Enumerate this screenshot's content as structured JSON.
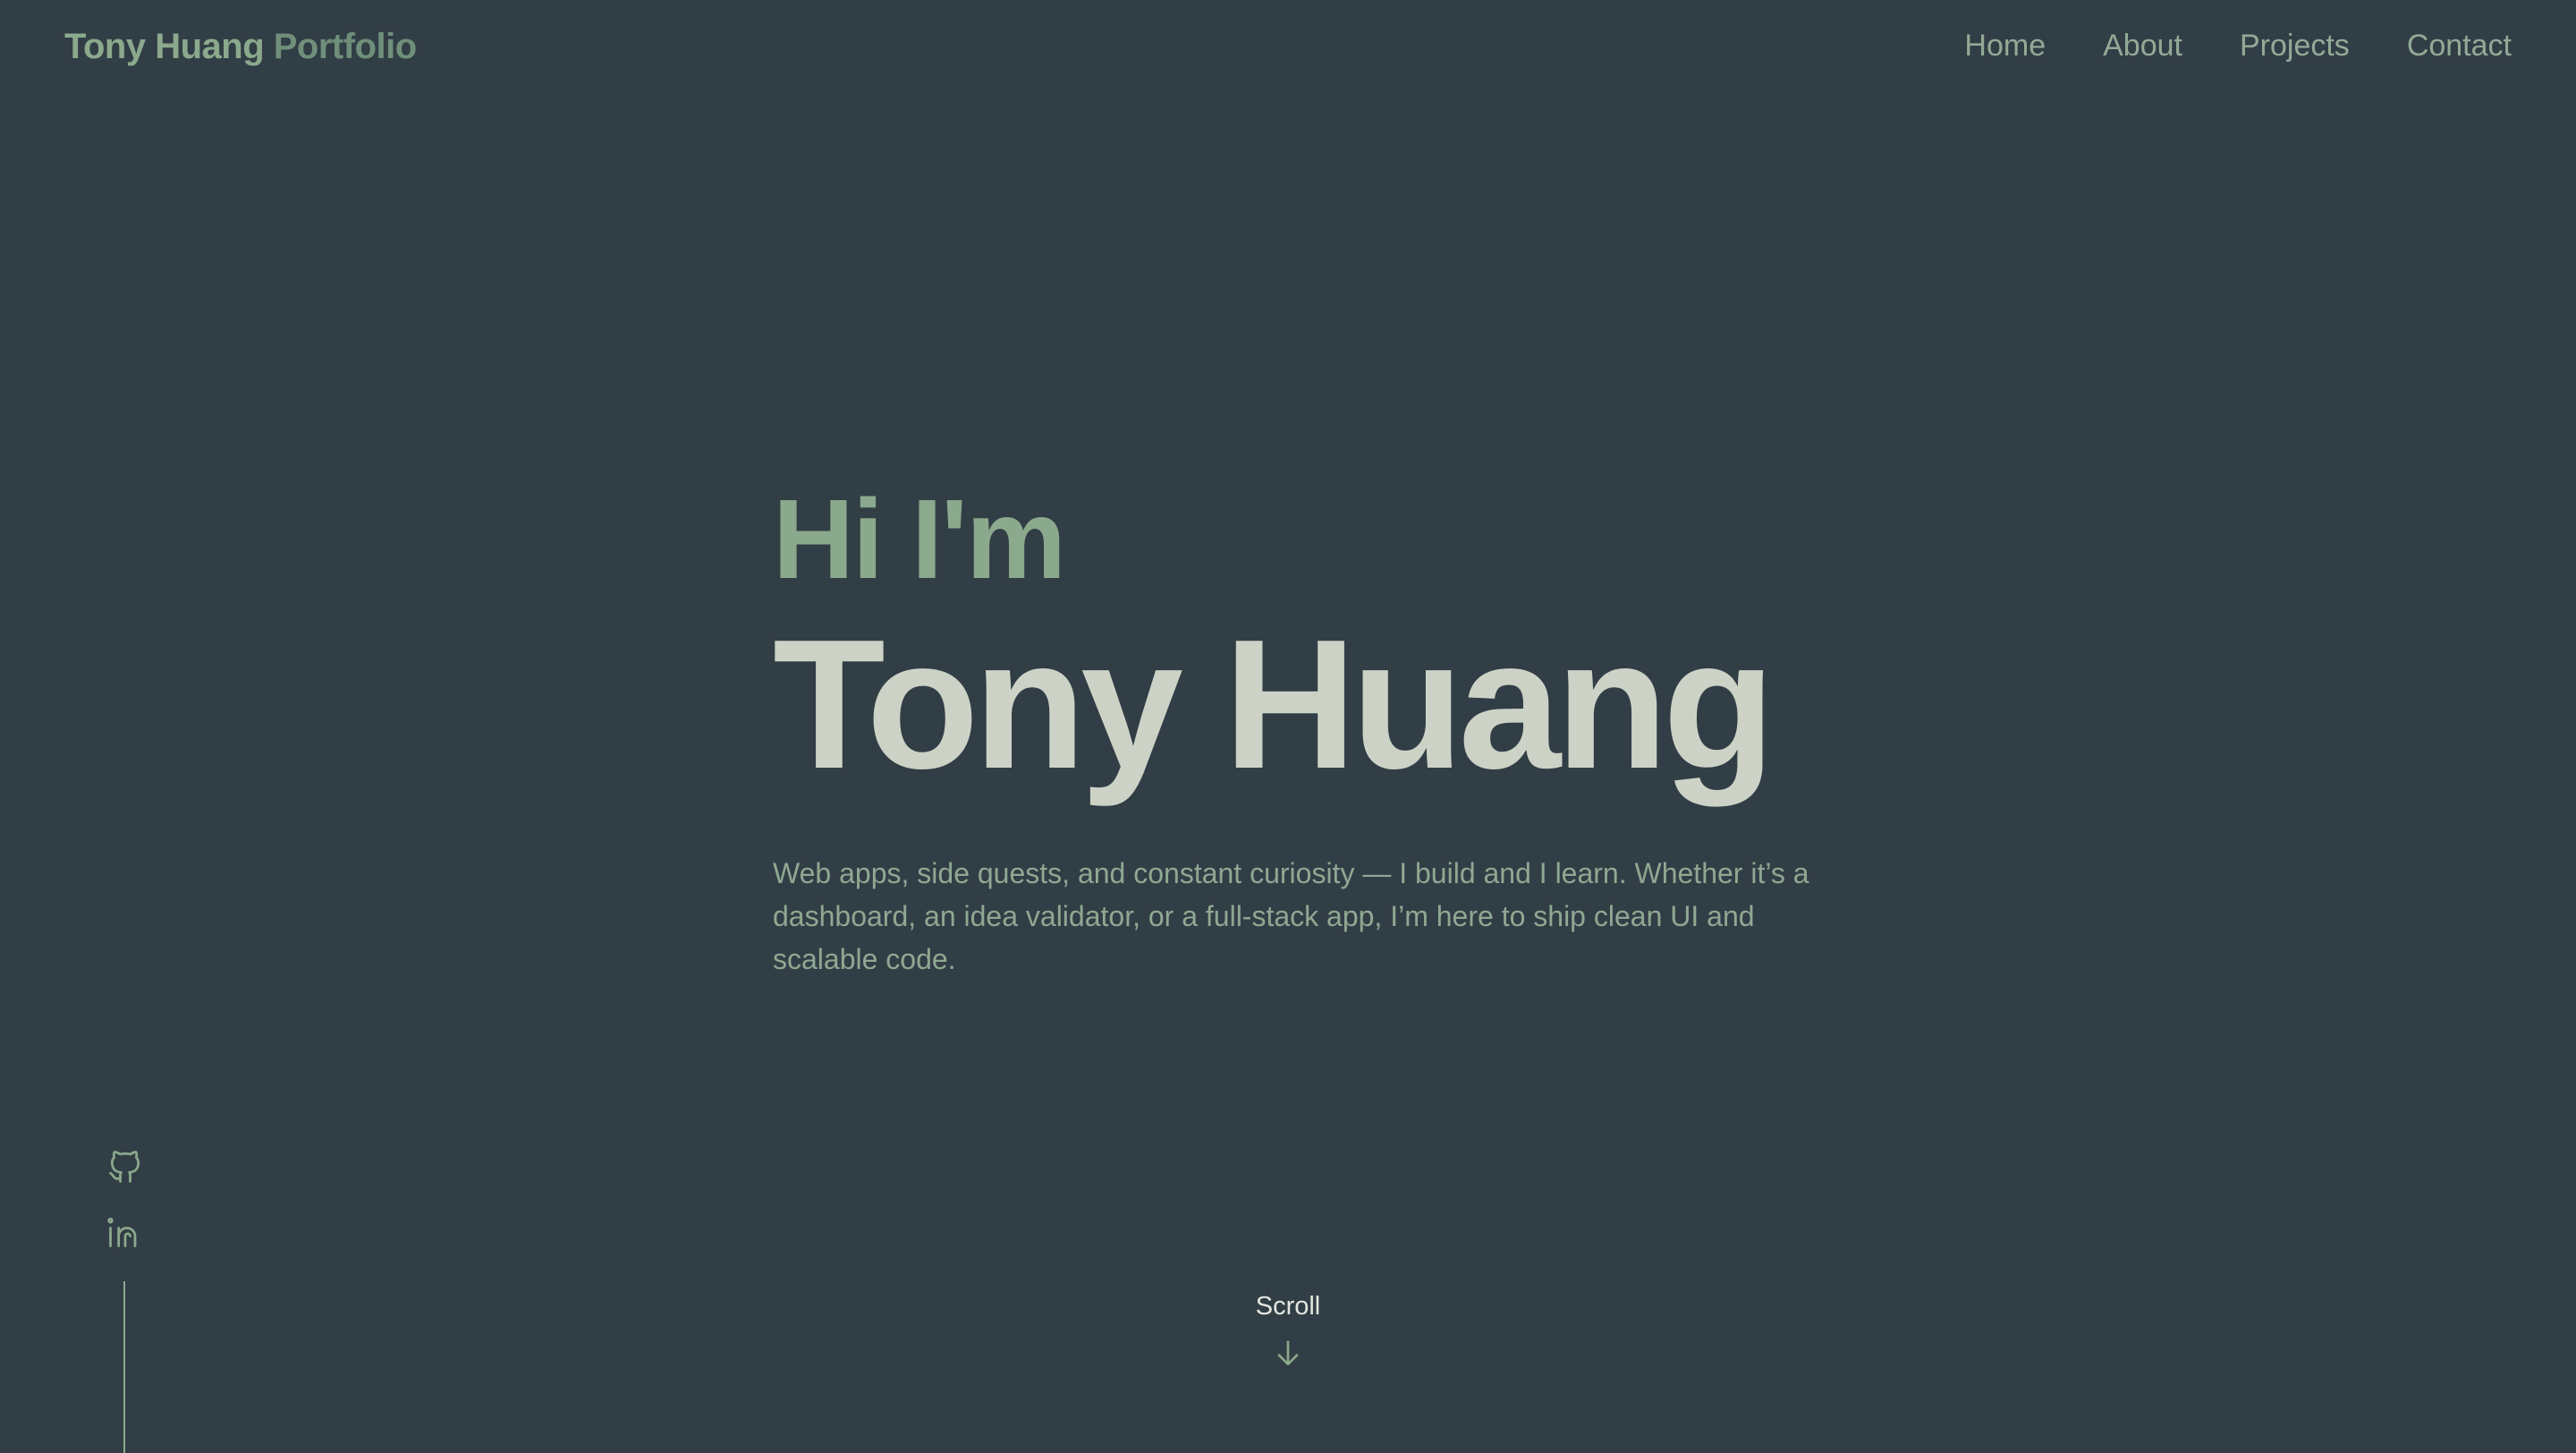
{
  "header": {
    "brand_name": "Tony Huang",
    "brand_suffix": "Portfolio",
    "nav": [
      "Home",
      "About",
      "Projects",
      "Contact"
    ]
  },
  "hero": {
    "greeting": "Hi I'm",
    "name": "Tony Huang",
    "tagline": "Web apps, side quests, and constant curiosity — I build and I learn. Whether it’s a dashboard, an idea validator, or a full-stack app, I’m here to ship clean UI and scalable code."
  },
  "social": {
    "icons": [
      "github-icon",
      "linkedin-icon"
    ]
  },
  "scroll": {
    "label": "Scroll",
    "icon": "arrow-down-icon"
  },
  "colors": {
    "background": "#323e46",
    "accent": "#8ba98c",
    "name": "#ccd3c6",
    "text_muted": "#8fa892"
  }
}
